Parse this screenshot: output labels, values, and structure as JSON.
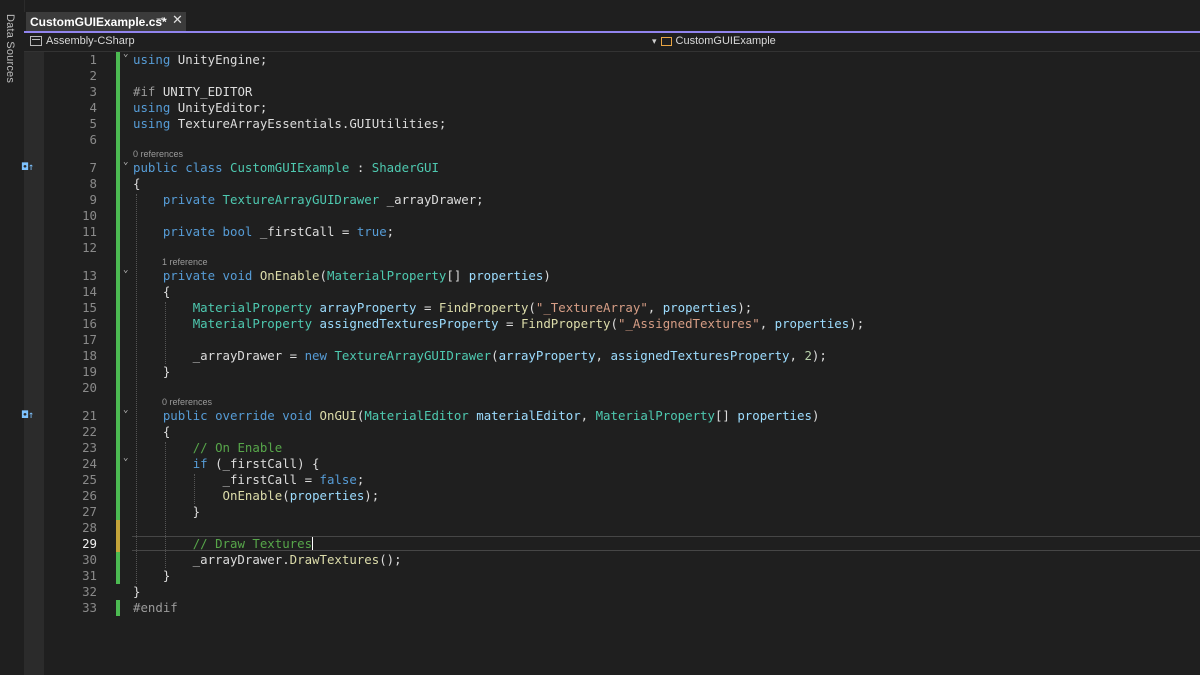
{
  "side_rail": {
    "label": "Data Sources"
  },
  "tab": {
    "title": "CustomGUIExample.cs*",
    "pin": "⊸",
    "close": "✕"
  },
  "nav": {
    "project": "Assembly-CSharp",
    "class_scope": "CustomGUIExample"
  },
  "code_lens": {
    "line7": "0 references",
    "line13": "1 reference",
    "line21": "0 references"
  },
  "lines": {
    "l1": {
      "n": "1",
      "t": [
        [
          "kw",
          "using"
        ],
        [
          "var",
          " UnityEngine;"
        ]
      ]
    },
    "l2": {
      "n": "2",
      "t": []
    },
    "l3": {
      "n": "3",
      "t": [
        [
          "pre",
          "#if"
        ],
        [
          "var",
          " UNITY_EDITOR"
        ]
      ]
    },
    "l4": {
      "n": "4",
      "t": [
        [
          "kw",
          "using"
        ],
        [
          "var",
          " UnityEditor;"
        ]
      ]
    },
    "l5": {
      "n": "5",
      "t": [
        [
          "kw",
          "using"
        ],
        [
          "var",
          " TextureArrayEssentials.GUIUtilities;"
        ]
      ]
    },
    "l6": {
      "n": "6",
      "t": []
    },
    "l7": {
      "n": "7",
      "t": [
        [
          "kw",
          "public"
        ],
        [
          "var",
          " "
        ],
        [
          "kw",
          "class"
        ],
        [
          "var",
          " "
        ],
        [
          "ty",
          "CustomGUIExample"
        ],
        [
          "var",
          " : "
        ],
        [
          "ty",
          "ShaderGUI"
        ]
      ]
    },
    "l8": {
      "n": "8",
      "t": [
        [
          "var",
          "{"
        ]
      ]
    },
    "l9": {
      "n": "9",
      "t": [
        [
          "var",
          "    "
        ],
        [
          "kw",
          "private"
        ],
        [
          "var",
          " "
        ],
        [
          "ty",
          "TextureArrayGUIDrawer"
        ],
        [
          "var",
          " _arrayDrawer;"
        ]
      ]
    },
    "l10": {
      "n": "10",
      "t": []
    },
    "l11": {
      "n": "11",
      "t": [
        [
          "var",
          "    "
        ],
        [
          "kw",
          "private"
        ],
        [
          "var",
          " "
        ],
        [
          "kw",
          "bool"
        ],
        [
          "var",
          " _firstCall = "
        ],
        [
          "kw",
          "true"
        ],
        [
          "var",
          ";"
        ]
      ]
    },
    "l12": {
      "n": "12",
      "t": []
    },
    "l13": {
      "n": "13",
      "t": [
        [
          "var",
          "    "
        ],
        [
          "kw",
          "private"
        ],
        [
          "var",
          " "
        ],
        [
          "kw",
          "void"
        ],
        [
          "var",
          " "
        ],
        [
          "fn",
          "OnEnable"
        ],
        [
          "var",
          "("
        ],
        [
          "ty",
          "MaterialProperty"
        ],
        [
          "var",
          "[] "
        ],
        [
          "prm",
          "properties"
        ],
        [
          "var",
          ")"
        ]
      ]
    },
    "l14": {
      "n": "14",
      "t": [
        [
          "var",
          "    {"
        ]
      ]
    },
    "l15": {
      "n": "15",
      "t": [
        [
          "var",
          "        "
        ],
        [
          "ty",
          "MaterialProperty"
        ],
        [
          "var",
          " "
        ],
        [
          "prm",
          "arrayProperty"
        ],
        [
          "var",
          " = "
        ],
        [
          "fn",
          "FindProperty"
        ],
        [
          "var",
          "("
        ],
        [
          "str",
          "\"_TextureArray\""
        ],
        [
          "var",
          ", "
        ],
        [
          "prm",
          "properties"
        ],
        [
          "var",
          ");"
        ]
      ]
    },
    "l16": {
      "n": "16",
      "t": [
        [
          "var",
          "        "
        ],
        [
          "ty",
          "MaterialProperty"
        ],
        [
          "var",
          " "
        ],
        [
          "prm",
          "assignedTexturesProperty"
        ],
        [
          "var",
          " = "
        ],
        [
          "fn",
          "FindProperty"
        ],
        [
          "var",
          "("
        ],
        [
          "str",
          "\"_AssignedTextures\""
        ],
        [
          "var",
          ", "
        ],
        [
          "prm",
          "properties"
        ],
        [
          "var",
          ");"
        ]
      ]
    },
    "l17": {
      "n": "17",
      "t": []
    },
    "l18": {
      "n": "18",
      "t": [
        [
          "var",
          "        _arrayDrawer = "
        ],
        [
          "kw",
          "new"
        ],
        [
          "var",
          " "
        ],
        [
          "ty",
          "TextureArrayGUIDrawer"
        ],
        [
          "var",
          "("
        ],
        [
          "prm",
          "arrayProperty"
        ],
        [
          "var",
          ", "
        ],
        [
          "prm",
          "assignedTexturesProperty"
        ],
        [
          "var",
          ", "
        ],
        [
          "num",
          "2"
        ],
        [
          "var",
          ");"
        ]
      ]
    },
    "l19": {
      "n": "19",
      "t": [
        [
          "var",
          "    }"
        ]
      ]
    },
    "l20": {
      "n": "20",
      "t": []
    },
    "l21": {
      "n": "21",
      "t": [
        [
          "var",
          "    "
        ],
        [
          "kw",
          "public"
        ],
        [
          "var",
          " "
        ],
        [
          "kw",
          "override"
        ],
        [
          "var",
          " "
        ],
        [
          "kw",
          "void"
        ],
        [
          "var",
          " "
        ],
        [
          "fn",
          "OnGUI"
        ],
        [
          "var",
          "("
        ],
        [
          "ty",
          "MaterialEditor"
        ],
        [
          "var",
          " "
        ],
        [
          "prm",
          "materialEditor"
        ],
        [
          "var",
          ", "
        ],
        [
          "ty",
          "MaterialProperty"
        ],
        [
          "var",
          "[] "
        ],
        [
          "prm",
          "properties"
        ],
        [
          "var",
          ")"
        ]
      ]
    },
    "l22": {
      "n": "22",
      "t": [
        [
          "var",
          "    {"
        ]
      ]
    },
    "l23": {
      "n": "23",
      "t": [
        [
          "var",
          "        "
        ],
        [
          "cmt",
          "// On Enable"
        ]
      ]
    },
    "l24": {
      "n": "24",
      "t": [
        [
          "var",
          "        "
        ],
        [
          "kw",
          "if"
        ],
        [
          "var",
          " (_firstCall) {"
        ]
      ]
    },
    "l25": {
      "n": "25",
      "t": [
        [
          "var",
          "            _firstCall = "
        ],
        [
          "kw",
          "false"
        ],
        [
          "var",
          ";"
        ]
      ]
    },
    "l26": {
      "n": "26",
      "t": [
        [
          "var",
          "            "
        ],
        [
          "fn",
          "OnEnable"
        ],
        [
          "var",
          "("
        ],
        [
          "prm",
          "properties"
        ],
        [
          "var",
          ");"
        ]
      ]
    },
    "l27": {
      "n": "27",
      "t": [
        [
          "var",
          "        }"
        ]
      ]
    },
    "l28": {
      "n": "28",
      "t": []
    },
    "l29": {
      "n": "29",
      "t": [
        [
          "var",
          "        "
        ],
        [
          "cmt",
          "// Draw Textures"
        ]
      ]
    },
    "l30": {
      "n": "30",
      "t": [
        [
          "var",
          "        _arrayDrawer."
        ],
        [
          "fn",
          "DrawTextures"
        ],
        [
          "var",
          "();"
        ]
      ]
    },
    "l31": {
      "n": "31",
      "t": [
        [
          "var",
          "    }"
        ]
      ]
    },
    "l32": {
      "n": "32",
      "t": [
        [
          "var",
          "}"
        ]
      ]
    },
    "l33": {
      "n": "33",
      "t": [
        [
          "pre",
          "#endif"
        ]
      ]
    }
  },
  "cursor": {
    "line": "29"
  },
  "colors": {
    "keyword": "#569cd6",
    "type": "#4ec9b0",
    "method": "#dcdcaa",
    "string": "#d69d85",
    "comment": "#57a64a",
    "change_bar": "#4cba52",
    "tab_accent": "#9184ee"
  }
}
